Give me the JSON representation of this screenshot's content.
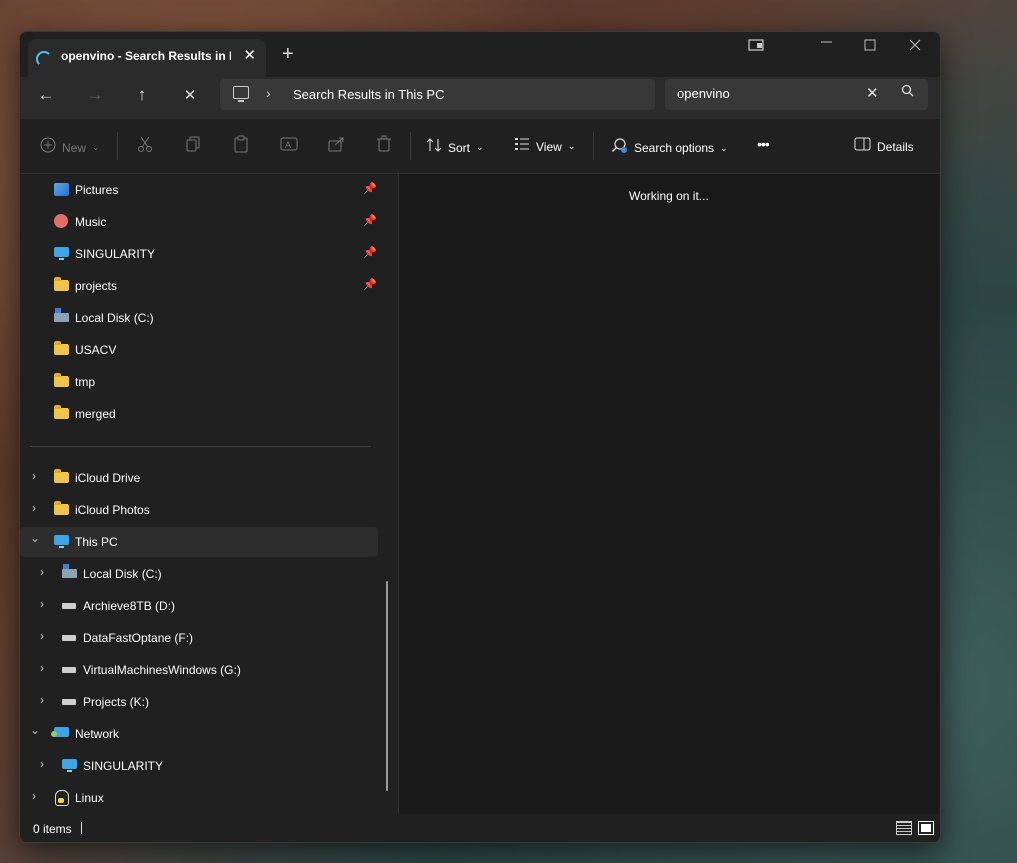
{
  "window": {
    "tab_title": "openvino - Search Results in Lo",
    "new_tab": "+",
    "tab_close": "✕"
  },
  "nav": {
    "back": "←",
    "forward": "→",
    "up": "↑",
    "stop": "✕"
  },
  "address": {
    "path": "Search Results in This PC",
    "chevron": "›"
  },
  "search": {
    "value": "openvino",
    "clear": "✕"
  },
  "toolbar": {
    "new_label": "New",
    "sort_label": "Sort",
    "view_label": "View",
    "search_options_label": "Search options",
    "more_label": "•••",
    "details_label": "Details"
  },
  "sidebar": {
    "quick_access": [
      {
        "label": "Pictures",
        "icon": "pictures-icon",
        "pinned": true
      },
      {
        "label": "Music",
        "icon": "music-icon",
        "pinned": true
      },
      {
        "label": "SINGULARITY",
        "icon": "monitor-icon",
        "pinned": true
      },
      {
        "label": "projects",
        "icon": "folder-icon",
        "pinned": true
      },
      {
        "label": "Local Disk (C:)",
        "icon": "disk-icon",
        "pinned": false
      },
      {
        "label": "USACV",
        "icon": "folder-icon",
        "pinned": false
      },
      {
        "label": "tmp",
        "icon": "folder-icon",
        "pinned": false
      },
      {
        "label": "merged",
        "icon": "folder-icon",
        "pinned": false
      }
    ],
    "tree": [
      {
        "label": "iCloud Drive",
        "icon": "folder-icon",
        "expander": "›",
        "level": 0
      },
      {
        "label": "iCloud Photos",
        "icon": "folder-icon",
        "expander": "›",
        "level": 0
      },
      {
        "label": "This PC",
        "icon": "monitor-icon",
        "expander": "⌄",
        "level": 0,
        "selected": true
      },
      {
        "label": "Local Disk (C:)",
        "icon": "disk-icon",
        "expander": "›",
        "level": 1
      },
      {
        "label": "Archieve8TB (D:)",
        "icon": "drive-icon",
        "expander": "›",
        "level": 1
      },
      {
        "label": "DataFastOptane (F:)",
        "icon": "drive-icon",
        "expander": "›",
        "level": 1
      },
      {
        "label": "VirtualMachinesWindows (G:)",
        "icon": "drive-icon",
        "expander": "›",
        "level": 1
      },
      {
        "label": "Projects (K:)",
        "icon": "drive-icon",
        "expander": "›",
        "level": 1
      },
      {
        "label": "Network",
        "icon": "network-icon",
        "expander": "⌄",
        "level": 0
      },
      {
        "label": "SINGULARITY",
        "icon": "monitor-icon",
        "expander": "›",
        "level": 1
      },
      {
        "label": "Linux",
        "icon": "penguin-icon",
        "expander": "›",
        "level": 0
      }
    ]
  },
  "content": {
    "status_message": "Working on it..."
  },
  "statusbar": {
    "item_count": "0 items"
  }
}
